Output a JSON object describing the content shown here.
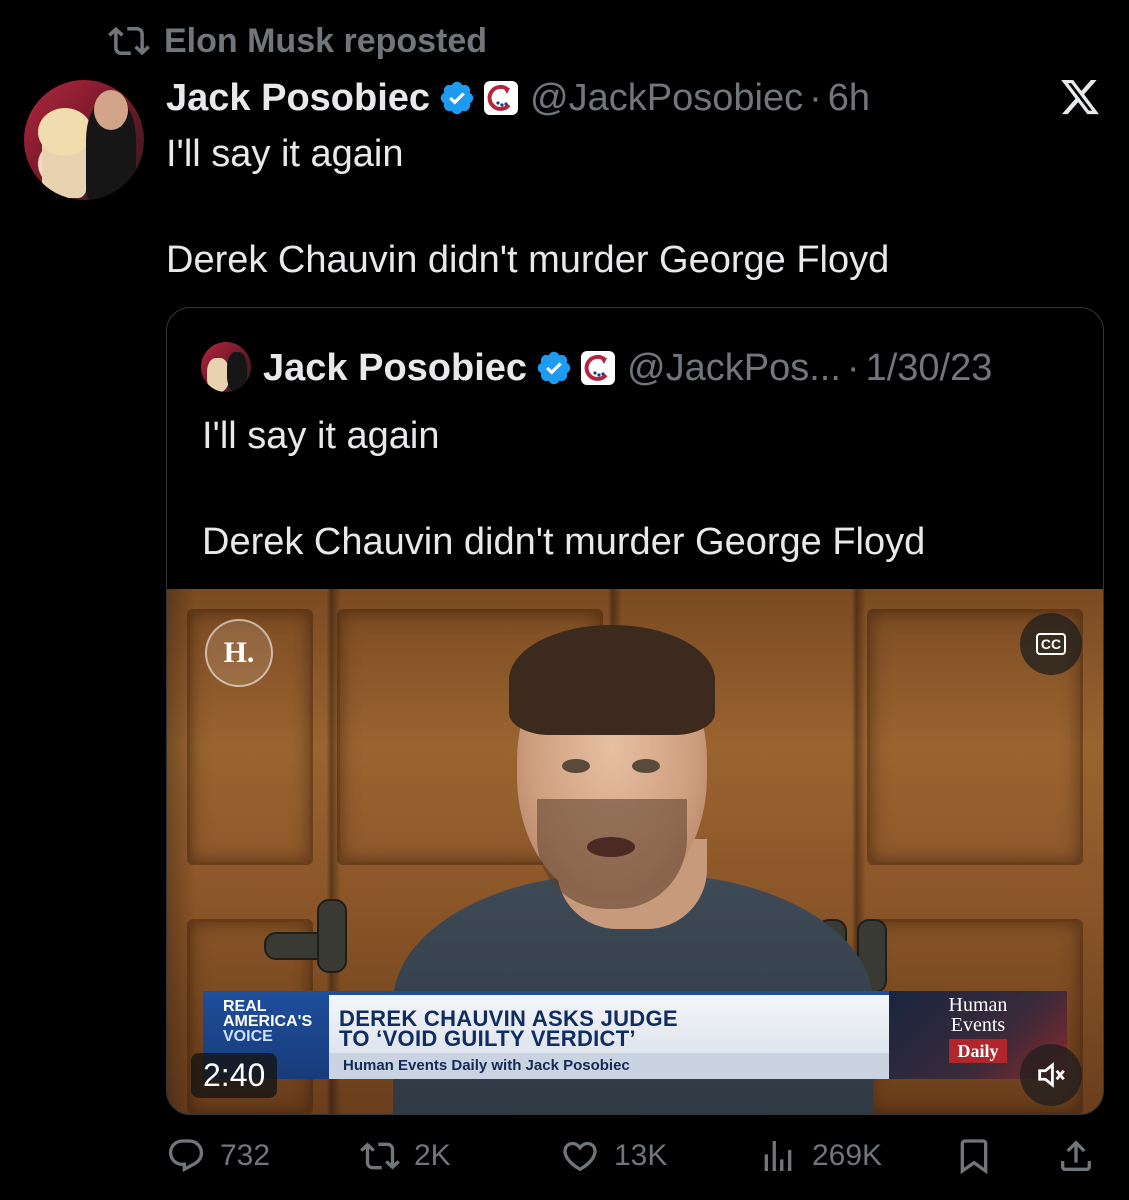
{
  "repost": {
    "label": "Elon Musk reposted"
  },
  "post": {
    "author_name": "Jack Posobiec",
    "handle": "@JackPosobiec",
    "separator": "·",
    "time": "6h",
    "text_line1": "I'll say it again",
    "text_line2": "Derek Chauvin didn't murder George Floyd"
  },
  "quote": {
    "author_name": "Jack Posobiec",
    "handle": "@JackPos...",
    "separator": "·",
    "date": "1/30/23",
    "text_line1": "I'll say it again",
    "text_line2": "Derek Chauvin didn't murder George Floyd"
  },
  "video": {
    "logo_letter": "H.",
    "cc_label": "CC",
    "duration": "2:40",
    "lower_third": {
      "network_line1": "REAL",
      "network_line2": "AMERICA'S",
      "network_line3": "VOICE",
      "headline_line1": "DEREK CHAUVIN ASKS JUDGE",
      "headline_line2": "TO ‘VOID GUILTY VERDICT’",
      "subline": "Human Events Daily with Jack Posobiec",
      "show_line1": "Human",
      "show_line2": "Events",
      "show_line3": "Daily"
    }
  },
  "actions": {
    "replies": "732",
    "reposts": "2K",
    "likes": "13K",
    "views": "269K"
  },
  "icons": {
    "repost": "repost-icon",
    "verified": "verified-badge-icon",
    "affiliate": "affiliate-badge-icon",
    "x_logo": "x-logo-icon",
    "cc": "closed-captions-icon",
    "mute": "mute-icon",
    "reply": "reply-icon",
    "like": "heart-icon",
    "views": "views-icon",
    "bookmark": "bookmark-icon",
    "share": "share-icon"
  },
  "colors": {
    "background": "#000000",
    "primary_text": "#e7e9ea",
    "secondary_text": "#71767b",
    "verified_blue": "#1d9bf0",
    "border": "#333639"
  }
}
